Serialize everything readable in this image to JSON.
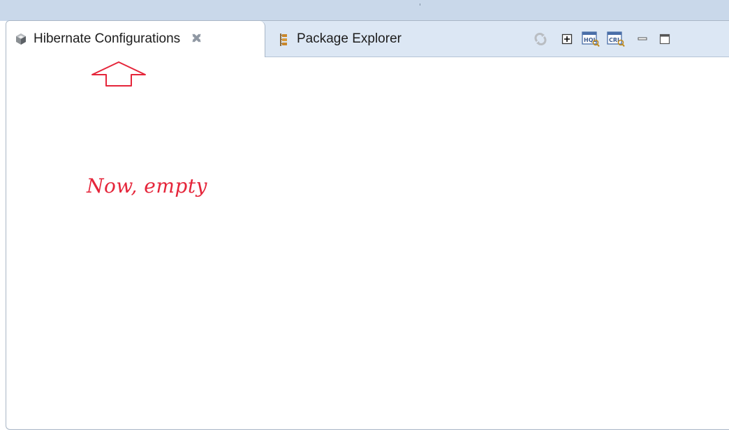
{
  "tabs": [
    {
      "label": "Hibernate Configurations",
      "icon": "hibernate-icon",
      "active": true,
      "closable": true
    },
    {
      "label": "Package Explorer",
      "icon": "package-explorer-icon",
      "active": false,
      "closable": false
    }
  ],
  "toolbar": {
    "items": [
      "refresh-icon",
      "expand-all-icon",
      "hql-editor-icon",
      "criteria-editor-icon",
      "minimize-icon",
      "maximize-icon"
    ]
  },
  "annotation": {
    "text": "Now, empty",
    "arrow": "up-arrow-icon",
    "color": "#e5253a"
  },
  "colors": {
    "tabstrip_bg": "#dce7f4",
    "window_bg": "#c9d8ea",
    "panel_border": "#a9b6c6"
  }
}
